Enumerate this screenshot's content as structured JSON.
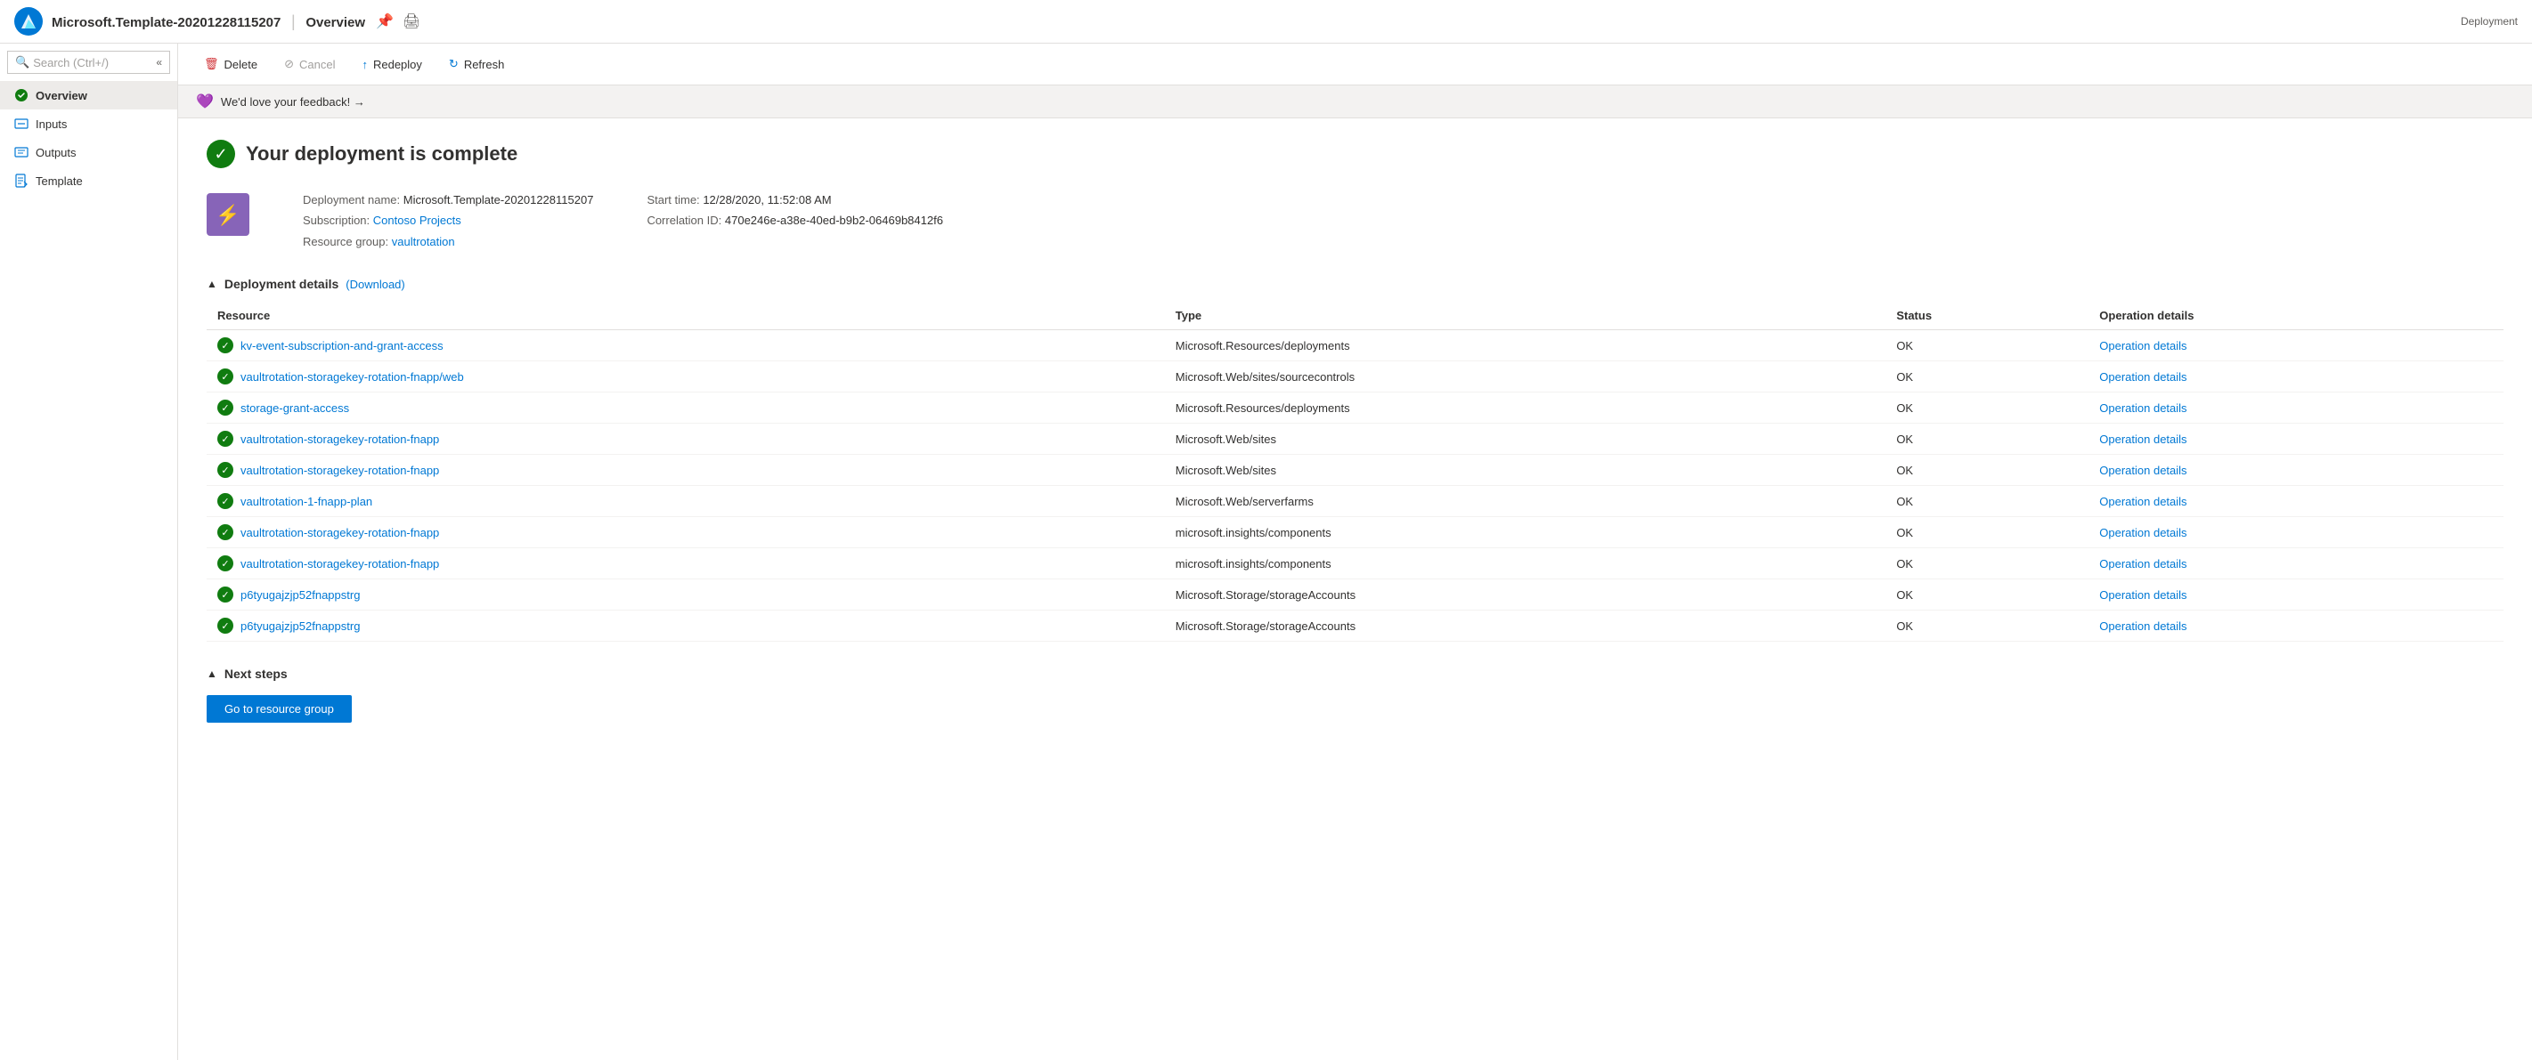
{
  "topbar": {
    "title": "Microsoft.Template-20201228115207",
    "separator": "|",
    "section": "Overview",
    "subtitle": "Deployment"
  },
  "search": {
    "placeholder": "Search (Ctrl+/)"
  },
  "sidebar": {
    "items": [
      {
        "id": "overview",
        "label": "Overview",
        "active": true
      },
      {
        "id": "inputs",
        "label": "Inputs",
        "active": false
      },
      {
        "id": "outputs",
        "label": "Outputs",
        "active": false
      },
      {
        "id": "template",
        "label": "Template",
        "active": false
      }
    ]
  },
  "toolbar": {
    "delete_label": "Delete",
    "cancel_label": "Cancel",
    "redeploy_label": "Redeploy",
    "refresh_label": "Refresh"
  },
  "feedback": {
    "text": "We'd love your feedback! →"
  },
  "deployment": {
    "complete_heading": "Your deployment is complete",
    "name_label": "Deployment name:",
    "name_value": "Microsoft.Template-20201228115207",
    "subscription_label": "Subscription:",
    "subscription_value": "Contoso Projects",
    "resource_group_label": "Resource group:",
    "resource_group_value": "vaultrotation",
    "start_time_label": "Start time:",
    "start_time_value": "12/28/2020, 11:52:08 AM",
    "correlation_label": "Correlation ID:",
    "correlation_value": "470e246e-a38e-40ed-b9b2-06469b8412f6",
    "details_heading": "Deployment details",
    "download_label": "(Download)",
    "table": {
      "columns": [
        "Resource",
        "Type",
        "Status",
        "Operation details"
      ],
      "rows": [
        {
          "resource": "kv-event-subscription-and-grant-access",
          "type": "Microsoft.Resources/deployments",
          "status": "OK"
        },
        {
          "resource": "vaultrotation-storagekey-rotation-fnapp/web",
          "type": "Microsoft.Web/sites/sourcecontrols",
          "status": "OK"
        },
        {
          "resource": "storage-grant-access",
          "type": "Microsoft.Resources/deployments",
          "status": "OK"
        },
        {
          "resource": "vaultrotation-storagekey-rotation-fnapp",
          "type": "Microsoft.Web/sites",
          "status": "OK"
        },
        {
          "resource": "vaultrotation-storagekey-rotation-fnapp",
          "type": "Microsoft.Web/sites",
          "status": "OK"
        },
        {
          "resource": "vaultrotation-1-fnapp-plan",
          "type": "Microsoft.Web/serverfarms",
          "status": "OK"
        },
        {
          "resource": "vaultrotation-storagekey-rotation-fnapp",
          "type": "microsoft.insights/components",
          "status": "OK"
        },
        {
          "resource": "vaultrotation-storagekey-rotation-fnapp",
          "type": "microsoft.insights/components",
          "status": "OK"
        },
        {
          "resource": "p6tyugajzjp52fnappstrg",
          "type": "Microsoft.Storage/storageAccounts",
          "status": "OK"
        },
        {
          "resource": "p6tyugajzjp52fnappstrg",
          "type": "Microsoft.Storage/storageAccounts",
          "status": "OK"
        }
      ],
      "op_details_label": "Operation details"
    },
    "next_steps_heading": "Next steps",
    "go_to_rg_label": "Go to resource group"
  }
}
